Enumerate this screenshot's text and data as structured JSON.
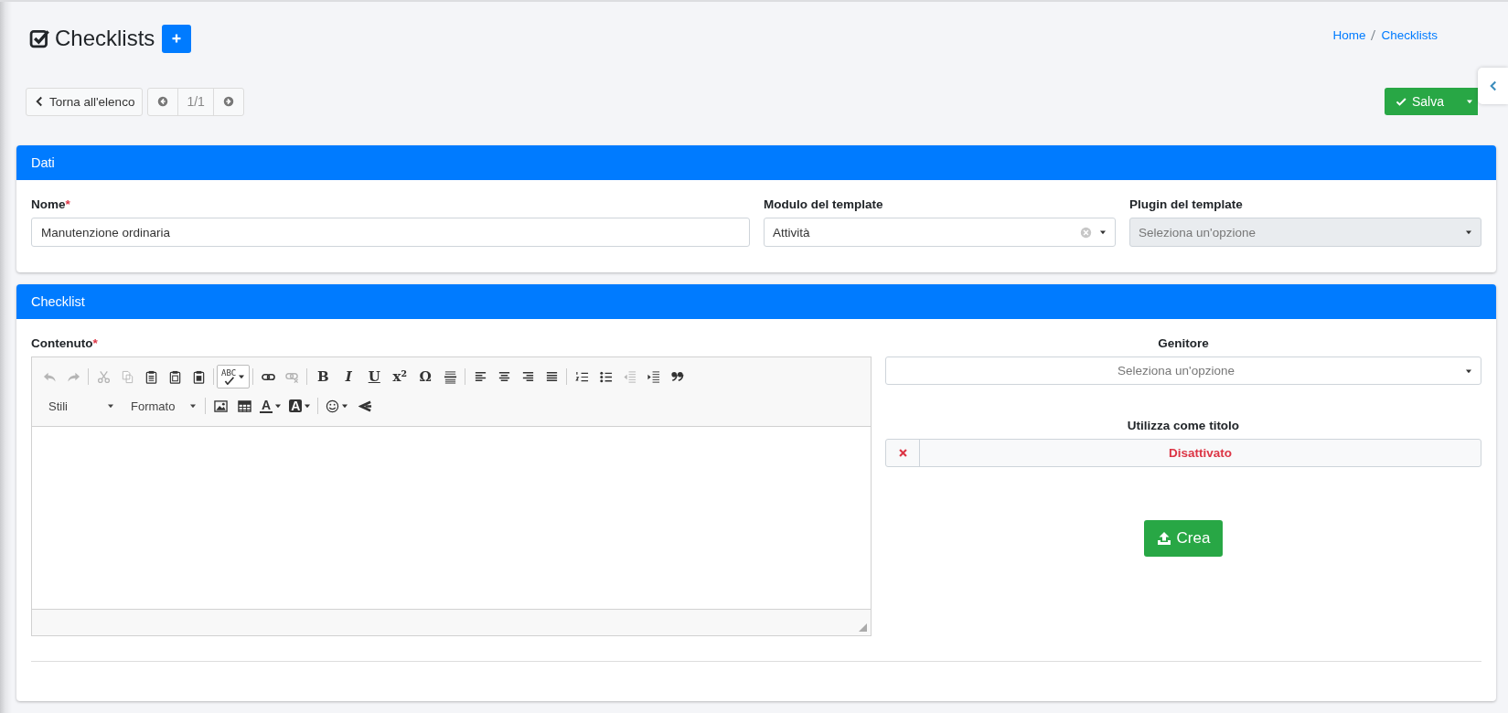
{
  "page": {
    "title": "Checklists",
    "breadcrumb": [
      {
        "label": "Home"
      },
      {
        "label": "Checklists"
      }
    ]
  },
  "toolbar": {
    "back_label": "Torna all'elenco",
    "pager": "1/1",
    "save_label": "Salva"
  },
  "cards": [
    {
      "title": "Dati",
      "fields": [
        {
          "kind": "text",
          "label": "Nome",
          "mark": "*",
          "value": "Manutenzione ordinaria"
        },
        {
          "kind": "select",
          "label": "Modulo del template",
          "value": "Attività",
          "clearable": true,
          "disabled": false
        },
        {
          "kind": "select",
          "label": "Plugin del template",
          "placeholder": "Seleziona un'opzione",
          "disabled": true
        }
      ]
    },
    {
      "title": "Checklist",
      "editor": {
        "label": "Contenuto",
        "mark": "*",
        "rows": [
          [
            [
              {
                "kind": "icon",
                "disabled": true
              },
              {
                "kind": "icon",
                "disabled": true
              }
            ],
            [
              {
                "kind": "icon",
                "disabled": true
              },
              {
                "kind": "icon",
                "disabled": true
              },
              {
                "kind": "icon",
                "disabled": false
              },
              {
                "kind": "icon",
                "disabled": false
              },
              {
                "kind": "icon",
                "disabled": false
              }
            ],
            [
              {
                "kind": "split",
                "text": "ABC",
                "selected": true
              }
            ],
            [
              {
                "kind": "icon",
                "disabled": false
              },
              {
                "kind": "icon",
                "disabled": true
              }
            ],
            [
              {
                "kind": "glyph",
                "text": "B"
              },
              {
                "kind": "glyph",
                "text": "I"
              },
              {
                "kind": "glyph",
                "text": "U"
              },
              {
                "kind": "glyph",
                "text": "x²"
              },
              {
                "kind": "glyph",
                "text": "Ω"
              },
              {
                "kind": "icon",
                "disabled": false
              }
            ],
            [
              {
                "kind": "icon",
                "disabled": false
              },
              {
                "kind": "icon",
                "disabled": false
              },
              {
                "kind": "icon",
                "disabled": false
              },
              {
                "kind": "icon",
                "disabled": false
              }
            ],
            [
              {
                "kind": "icon",
                "disabled": false
              },
              {
                "kind": "icon",
                "disabled": false
              },
              {
                "kind": "icon",
                "disabled": true
              },
              {
                "kind": "icon",
                "disabled": false
              },
              {
                "kind": "icon",
                "disabled": false
              }
            ]
          ],
          [
            [
              {
                "kind": "combo",
                "text": "Stili"
              },
              {
                "kind": "combo",
                "text": "Formato"
              }
            ],
            [
              {
                "kind": "icon",
                "disabled": false
              },
              {
                "kind": "icon",
                "disabled": false
              },
              {
                "kind": "color",
                "text": "A"
              },
              {
                "kind": "color",
                "text": "A"
              }
            ],
            [
              {
                "kind": "menu-icon",
                "disabled": false
              },
              {
                "kind": "icon",
                "disabled": false
              }
            ]
          ]
        ]
      },
      "side": [
        {
          "kind": "select",
          "label": "Genitore",
          "placeholder": "Seleziona un'opzione"
        },
        {
          "kind": "switch",
          "label": "Utilizza come titolo",
          "on": false,
          "text": "Disattivato"
        }
      ],
      "action": "Crea"
    }
  ]
}
